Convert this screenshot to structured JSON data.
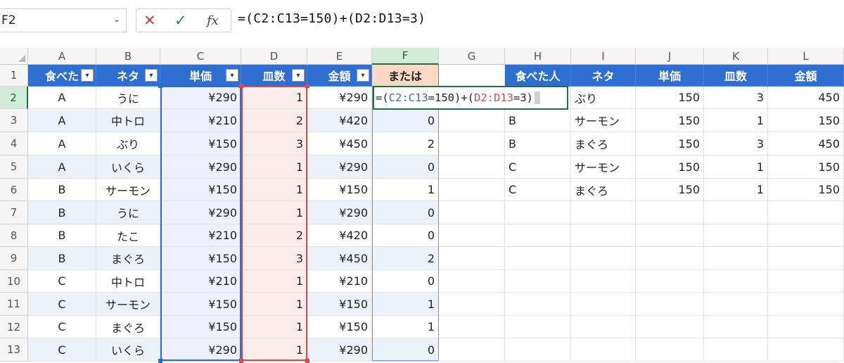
{
  "formula_bar": {
    "name_box": "F2",
    "formula": "=(C2:C13=150)+(D2:D13=3)"
  },
  "columns": [
    "A",
    "B",
    "C",
    "D",
    "E",
    "F",
    "G",
    "H",
    "I",
    "J",
    "K",
    "L"
  ],
  "active_column": "F",
  "active_row": "2",
  "row_numbers": [
    "1",
    "2",
    "3",
    "4",
    "5",
    "6",
    "7",
    "8",
    "9",
    "10",
    "11",
    "12",
    "13"
  ],
  "table1": {
    "headers": [
      "食べた",
      "ネタ",
      "単価",
      "皿数",
      "金額",
      "または"
    ],
    "rows": [
      [
        "A",
        "うに",
        "¥290",
        "1",
        "¥290",
        ""
      ],
      [
        "A",
        "中トロ",
        "¥210",
        "2",
        "¥420",
        "0"
      ],
      [
        "A",
        "ぶり",
        "¥150",
        "3",
        "¥450",
        "2"
      ],
      [
        "A",
        "いくら",
        "¥290",
        "1",
        "¥290",
        "0"
      ],
      [
        "B",
        "サーモン",
        "¥150",
        "1",
        "¥150",
        "1"
      ],
      [
        "B",
        "うに",
        "¥290",
        "1",
        "¥290",
        "0"
      ],
      [
        "B",
        "たこ",
        "¥210",
        "2",
        "¥420",
        "0"
      ],
      [
        "B",
        "まぐろ",
        "¥150",
        "3",
        "¥450",
        "2"
      ],
      [
        "C",
        "中トロ",
        "¥210",
        "1",
        "¥210",
        "0"
      ],
      [
        "C",
        "サーモン",
        "¥150",
        "1",
        "¥150",
        "1"
      ],
      [
        "C",
        "まぐろ",
        "¥150",
        "1",
        "¥150",
        "1"
      ],
      [
        "C",
        "いくら",
        "¥290",
        "1",
        "¥290",
        "0"
      ]
    ]
  },
  "editing_cell": {
    "p1": "=(",
    "r1": "C2:C13",
    "p2": "=150)+(",
    "r2": "D2:D13",
    "p3": "=3)"
  },
  "table2": {
    "headers": [
      "食べた人",
      "ネタ",
      "単価",
      "皿数",
      "金額"
    ],
    "rows": [
      [
        "",
        "ぶり",
        "150",
        "3",
        "450"
      ],
      [
        "B",
        "サーモン",
        "150",
        "1",
        "150"
      ],
      [
        "B",
        "まぐろ",
        "150",
        "3",
        "450"
      ],
      [
        "C",
        "サーモン",
        "150",
        "1",
        "150"
      ],
      [
        "C",
        "まぐろ",
        "150",
        "1",
        "150"
      ]
    ]
  },
  "colors": {
    "table_header": "#2e6ed0",
    "accent_header": "#fbd9c4",
    "ref_blue": "#2f6bd6",
    "ref_red": "#d84a4a",
    "selection_green": "#1e7145"
  }
}
